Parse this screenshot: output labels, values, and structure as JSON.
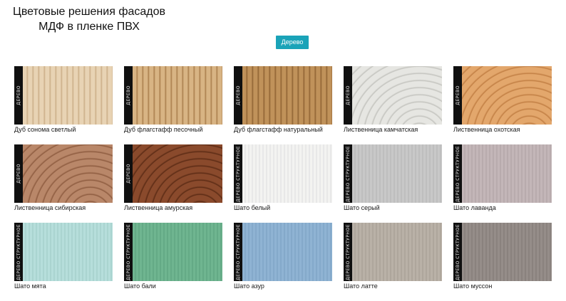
{
  "title_lines": [
    "Цветовые решения фасадов",
    "МДФ в пленке ПВХ"
  ],
  "filter_button": "Дерево",
  "swatches": [
    {
      "name": "Дуб сонома светлый",
      "strip": "ДЕРЕВО",
      "color": "#e8d3b4",
      "grain": "#c9ab84",
      "kind": "wood"
    },
    {
      "name": "Дуб флагстафф песочный",
      "strip": "ДЕРЕВО",
      "color": "#d8b484",
      "grain": "#a67a48",
      "kind": "wood"
    },
    {
      "name": "Дуб флагстафф натуральный",
      "strip": "ДЕРЕВО",
      "color": "#c0925a",
      "grain": "#8b5f30",
      "kind": "wood"
    },
    {
      "name": "Лиственница камчатская",
      "strip": "ДЕРЕВО",
      "color": "#e6e6e2",
      "grain": "#c2c2bd",
      "kind": "rings"
    },
    {
      "name": "Лиственница охотская",
      "strip": "ДЕРЕВО",
      "color": "#e3a76c",
      "grain": "#c07d42",
      "kind": "rings"
    },
    {
      "name": "Лиственница сибирская",
      "strip": "ДЕРЕВО",
      "color": "#b98769",
      "grain": "#8c5a3e",
      "kind": "rings"
    },
    {
      "name": "Лиственница амурская",
      "strip": "ДЕРЕВО",
      "color": "#8a4a2c",
      "grain": "#5a2a14",
      "kind": "rings"
    },
    {
      "name": "Шато белый",
      "strip": "ДЕРЕВО СТРУКТУРНОЕ",
      "color": "#f3f3f1",
      "grain": "#dedede",
      "kind": "fine"
    },
    {
      "name": "Шато серый",
      "strip": "ДЕРЕВО СТРУКТУРНОЕ",
      "color": "#c8c8c8",
      "grain": "#b4b4b4",
      "kind": "fine"
    },
    {
      "name": "Шато лаванда",
      "strip": "ДЕРЕВО СТРУКТУРНОЕ",
      "color": "#c3b6b8",
      "grain": "#aea0a2",
      "kind": "fine"
    },
    {
      "name": "Шато мята",
      "strip": "ДЕРЕВО СТРУКТУРНОЕ",
      "color": "#b6dedb",
      "grain": "#9ec9c6",
      "kind": "fine"
    },
    {
      "name": "Шато бали",
      "strip": "ДЕРЕВО СТРУКТУРНОЕ",
      "color": "#6fb590",
      "grain": "#5a9e7b",
      "kind": "fine"
    },
    {
      "name": "Шато азур",
      "strip": "ДЕРЕВО СТРУКТУРНОЕ",
      "color": "#8fb3d3",
      "grain": "#7a9fc0",
      "kind": "fine"
    },
    {
      "name": "Шато латте",
      "strip": "ДЕРЕВО СТРУКТУРНОЕ",
      "color": "#b9b1a7",
      "grain": "#a39b91",
      "kind": "fine"
    },
    {
      "name": "Шато муссон",
      "strip": "ДЕРЕВО СТРУКТУРНОЕ",
      "color": "#958d89",
      "grain": "#807874",
      "kind": "fine"
    }
  ]
}
